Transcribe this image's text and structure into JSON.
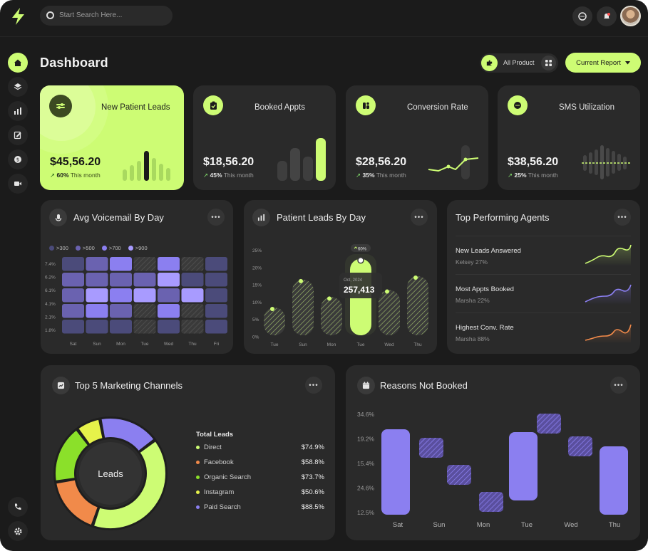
{
  "search": {
    "placeholder": "Start Search Here..."
  },
  "header": {
    "title": "Dashboard",
    "product_filter": "All Product",
    "report_button": "Current Report"
  },
  "kpis": [
    {
      "title": "New Patient Leads",
      "value": "$45,56.20",
      "change": "60%",
      "period": "This month",
      "icon": "switch-icon"
    },
    {
      "title": "Booked Appts",
      "value": "$18,56.20",
      "change": "45%",
      "period": "This month",
      "icon": "clipboard-icon"
    },
    {
      "title": "Conversion Rate",
      "value": "$28,56.20",
      "change": "35%",
      "period": "This month",
      "icon": "app-icon"
    },
    {
      "title": "SMS Utilization",
      "value": "$38,56.20",
      "change": "25%",
      "period": "This month",
      "icon": "chat-icon"
    }
  ],
  "voicemail": {
    "title": "Avg Voicemail By Day",
    "legend": [
      {
        "label": ">300",
        "color": "#4b4b7a"
      },
      {
        "label": ">500",
        "color": "#6a62b0"
      },
      {
        "label": ">700",
        "color": "#8b7ff0"
      },
      {
        "label": ">900",
        "color": "#a89bff"
      }
    ],
    "y_labels": [
      "7.4%",
      "6.2%",
      "6.1%",
      "4.1%",
      "2.1%",
      "1.8%"
    ],
    "x_labels": [
      "Sat",
      "Sun",
      "Mon",
      "Tue",
      "Wed",
      "Thu",
      "Fri"
    ],
    "grid": [
      [
        1,
        2,
        3,
        0,
        3,
        0,
        1
      ],
      [
        2,
        2,
        2,
        2,
        4,
        1,
        1
      ],
      [
        2,
        4,
        3,
        4,
        2,
        4,
        1
      ],
      [
        2,
        3,
        2,
        0,
        3,
        0,
        1
      ],
      [
        1,
        1,
        1,
        0,
        1,
        0,
        1
      ]
    ]
  },
  "patient_leads": {
    "title": "Patient Leads By Day",
    "y_labels": [
      "25%",
      "20%",
      "15%",
      "10%",
      "5%",
      "0%"
    ],
    "x_labels": [
      "Tue",
      "Sun",
      "Mon",
      "Tue",
      "Wed",
      "Thu"
    ],
    "values": [
      8,
      16,
      11,
      22,
      13,
      17
    ],
    "highlight_index": 3,
    "highlight_badge": "60%",
    "tooltip_date": "Oct, 2024",
    "tooltip_value": "257,413"
  },
  "agents": {
    "title": "Top Performing Agents",
    "rows": [
      {
        "label": "New Leads Answered",
        "sub": "Kelsey 27%",
        "color": "#cdfc74"
      },
      {
        "label": "Most Appts Booked",
        "sub": "Marsha 22%",
        "color": "#8b7ff0"
      },
      {
        "label": "Highest Conv. Rate",
        "sub": "Marsha 88%",
        "color": "#f18a4a"
      }
    ]
  },
  "marketing": {
    "title": "Top 5 Marketing Channels",
    "center_label": "Leads",
    "list_title": "Total Leads",
    "channels": [
      {
        "name": "Direct",
        "value": "$74.9%",
        "color": "#cdfc74"
      },
      {
        "name": "Facebook",
        "value": "$58.8%",
        "color": "#f18a4a"
      },
      {
        "name": "Organic Search",
        "value": "$73.7%",
        "color": "#8be02a"
      },
      {
        "name": "Instagram",
        "value": "$50.6%",
        "color": "#e6f24a"
      },
      {
        "name": "Paid Search",
        "value": "$88.5%",
        "color": "#8b7ff0"
      }
    ]
  },
  "reasons": {
    "title": "Reasons Not Booked",
    "y_labels": [
      "34.6%",
      "19.2%",
      "15.4%",
      "24.6%",
      "12.5%"
    ],
    "x_labels": [
      "Sat",
      "Sun",
      "Mon",
      "Tue",
      "Wed",
      "Thu"
    ]
  }
}
